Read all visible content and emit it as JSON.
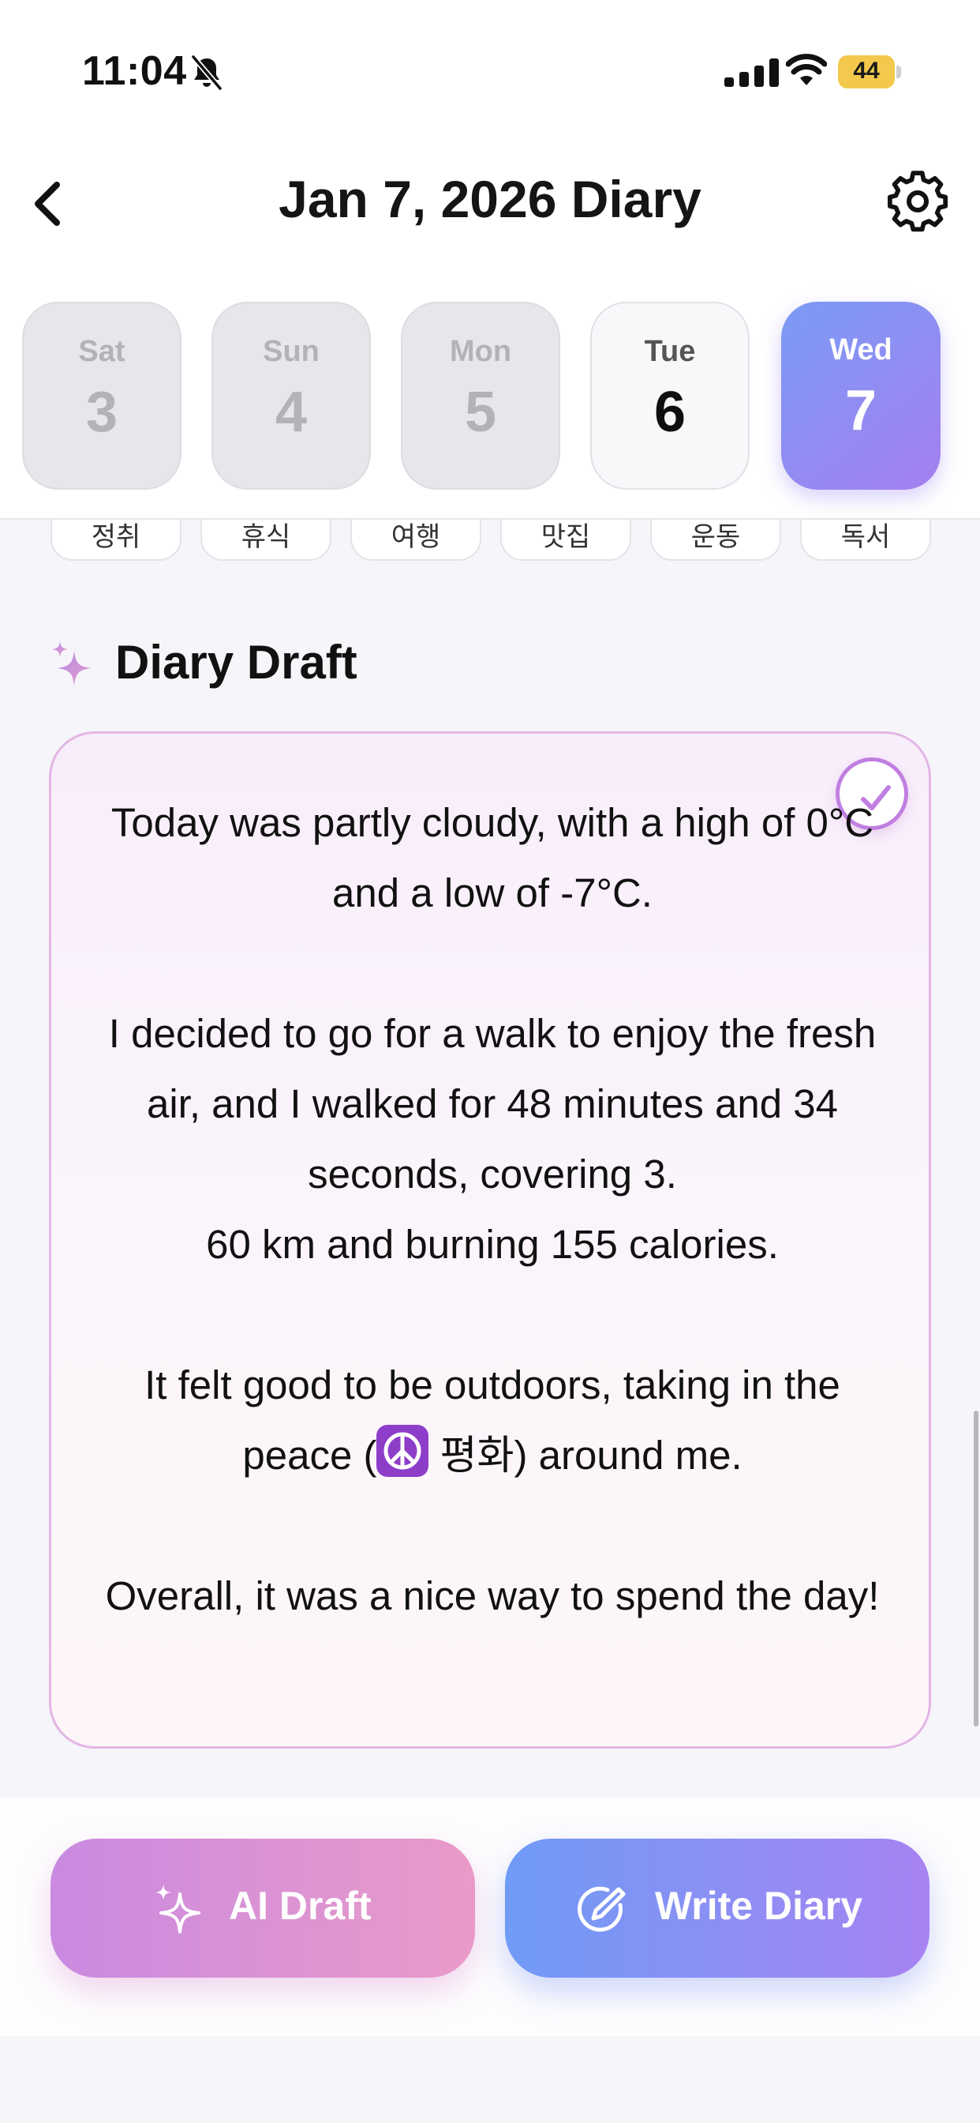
{
  "status_bar": {
    "time": "11:04",
    "battery": "44"
  },
  "header": {
    "title": "Jan 7, 2026 Diary"
  },
  "days": [
    {
      "name": "Sat",
      "num": "3",
      "state": "disabled"
    },
    {
      "name": "Sun",
      "num": "4",
      "state": "disabled"
    },
    {
      "name": "Mon",
      "num": "5",
      "state": "disabled"
    },
    {
      "name": "Tue",
      "num": "6",
      "state": "available"
    },
    {
      "name": "Wed",
      "num": "7",
      "state": "selected"
    }
  ],
  "tags": [
    "정취",
    "휴식",
    "여행",
    "맛집",
    "운동",
    "독서"
  ],
  "draft": {
    "heading": "Diary Draft",
    "paragraphs": [
      "Today was partly cloudy, with a high of 0°C and a low of -7°C.",
      "I decided to go for a walk to enjoy the fresh air, and I walked for 48 minutes and 34 seconds, covering 3.",
      "60 km and burning 155 calories.",
      "It felt good to be outdoors, taking in the peace (",
      " 평화) around me.",
      "Overall, it was a nice way to spend the day!"
    ]
  },
  "actions": {
    "ai_draft": "AI Draft",
    "write_diary": "Write Diary"
  },
  "colors": {
    "selected_day_gradient": [
      "#7a9bf5",
      "#a57ff0"
    ],
    "ai_button_gradient": [
      "#c98ae0",
      "#ea9ac8"
    ],
    "write_button_gradient": [
      "#6f9bf6",
      "#a783f2"
    ],
    "draft_border": "#e3b6e4"
  }
}
